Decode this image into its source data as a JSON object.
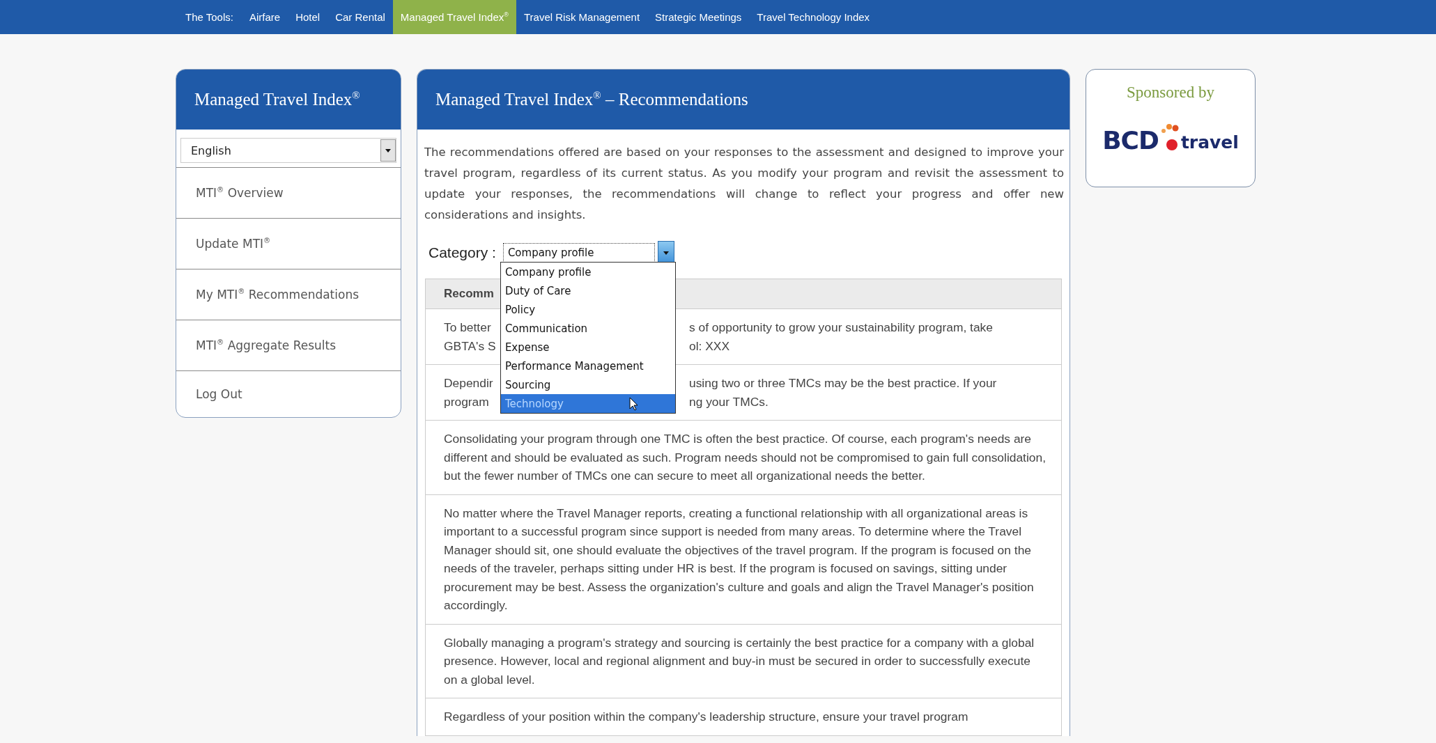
{
  "top_nav": {
    "label": "The Tools:",
    "items": [
      {
        "text": "Airfare",
        "selected": false
      },
      {
        "text": "Hotel",
        "selected": false
      },
      {
        "text": "Car Rental",
        "selected": false
      },
      {
        "text": "Managed Travel Index$^{®}$",
        "selected": true
      },
      {
        "text": "Travel Risk Management",
        "selected": false
      },
      {
        "text": "Strategic Meetings",
        "selected": false
      },
      {
        "text": "Travel Technology Index",
        "selected": false
      }
    ]
  },
  "sidebar": {
    "title": "Managed Travel Index$^{®}$",
    "language": "English",
    "items": [
      {
        "text": "MTI$^{®}$ Overview"
      },
      {
        "text": "Update MTI$^{®}$"
      },
      {
        "text": "My MTI$^{®}$ Recommendations"
      },
      {
        "text": "MTI$^{®}$ Aggregate Results"
      },
      {
        "text": "Log Out"
      }
    ]
  },
  "main": {
    "title": "Managed Travel Index$^{®}$ – Recommendations",
    "intro": "The recommendations offered are based on your responses to the assessment and designed to improve your travel program, regardless of its current status. As you modify your program and revisit the assessment to update your responses, the recommendations will change to reflect your progress and offer new considerations and insights.",
    "category_label": "Category :",
    "category_value": "Company profile",
    "category_options": [
      {
        "text": "Company profile",
        "selected": false
      },
      {
        "text": "Duty of Care",
        "selected": false
      },
      {
        "text": "Policy",
        "selected": false
      },
      {
        "text": "Communication",
        "selected": false
      },
      {
        "text": "Expense",
        "selected": false
      },
      {
        "text": "Performance Management",
        "selected": false
      },
      {
        "text": "Sourcing",
        "selected": false
      },
      {
        "text": "Technology",
        "selected": true
      }
    ],
    "table_header": "Recomm",
    "rows": [
      {
        "kind": "split",
        "lines": [
          [
            "To better",
            "s of opportunity to grow your sustainability program, take"
          ],
          [
            "GBTA's S",
            "ol: XXX"
          ]
        ]
      },
      {
        "kind": "split",
        "lines": [
          [
            "Dependir",
            "using two or three TMCs may be the best practice. If your"
          ],
          [
            "program",
            "ng your TMCs."
          ]
        ]
      },
      {
        "kind": "text",
        "text": "Consolidating your program through one TMC is often the best practice. Of course, each program's needs are different and should be evaluated as such. Program needs should not be compromised to gain full consolidation, but the fewer number of TMCs one can secure to meet all organizational needs the better."
      },
      {
        "kind": "text",
        "text": "No matter where the Travel Manager reports, creating a functional relationship with all organizational areas is important to a successful program since support is needed from many areas. To determine where the Travel Manager should sit, one should evaluate the objectives of the travel program. If the program is focused on the needs of the traveler, perhaps sitting under HR is best. If the program is focused on savings, sitting under procurement may be best. Assess the organization's culture and goals and align the Travel Manager's position accordingly."
      },
      {
        "kind": "text",
        "text": "Globally managing a program's strategy and sourcing is certainly the best practice for a company with a global presence. However, local and regional alignment and buy-in must be secured in order to successfully execute on a global level."
      },
      {
        "kind": "text",
        "text": "Regardless of your position within the company's leadership structure, ensure your travel program"
      }
    ]
  },
  "sponsor": {
    "label": "Sponsored by",
    "logo_left": "BCD",
    "logo_right": "travel"
  }
}
